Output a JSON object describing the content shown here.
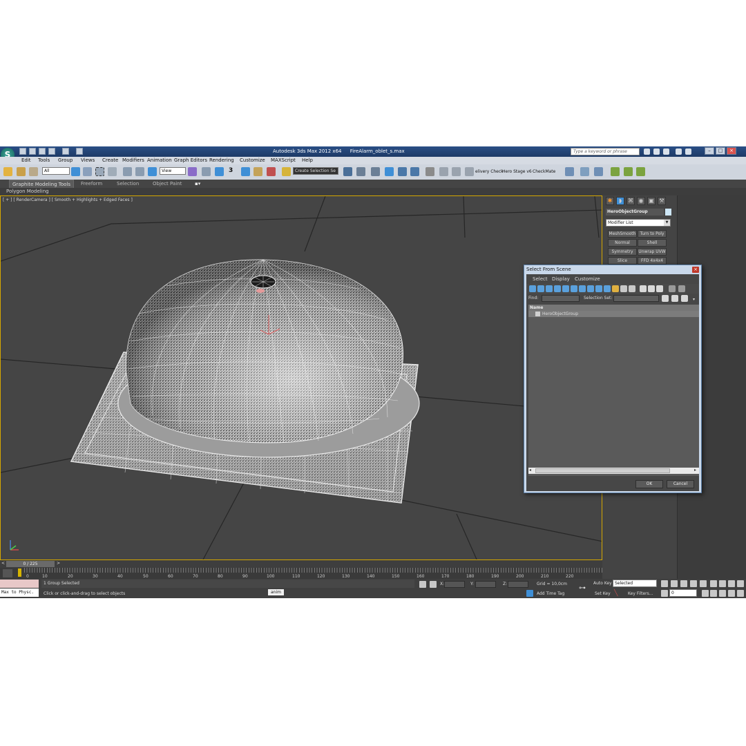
{
  "window": {
    "app_title": "Autodesk 3ds Max  2012 x64",
    "file_name": "FireAlarm_oblet_s.max",
    "search_placeholder": "Type a keyword or phrase",
    "logo_glyph": "S"
  },
  "menu": [
    "Edit",
    "Tools",
    "Group",
    "Views",
    "Create",
    "Modifiers",
    "Animation",
    "Graph Editors",
    "Rendering",
    "Customize",
    "MAXScript",
    "Help"
  ],
  "toolbar": {
    "selection_filter": "All",
    "ref_coord": "View",
    "named_selection_placeholder": "Create Selection Se",
    "snap_label": "3",
    "plugin_labels": [
      "elivery Check",
      "Hero Stage v6",
      "CheckMate"
    ]
  },
  "ribbon": {
    "tabs": [
      "Graphite Modeling Tools",
      "Freeform",
      "Selection",
      "Object Paint"
    ],
    "active_tab": "Graphite Modeling Tools",
    "sub_panel": "Polygon Modeling"
  },
  "viewport": {
    "label": "[ + ] [ RenderCamera ] [ Smooth + Highlights + Edged Faces ]"
  },
  "command_panel": {
    "object_name": "HeroObjectGroup",
    "object_color": "#cde6f5",
    "modifier_list_label": "Modifier List",
    "modifier_buttons": [
      "MeshSmooth",
      "Turn to Poly",
      "Normal",
      "Shell",
      "Symmetry",
      "Unwrap UVW",
      "Slice",
      "FFD 4x4x4"
    ]
  },
  "dialog": {
    "title": "Select From Scene",
    "menu": [
      "Select",
      "Display",
      "Customize"
    ],
    "find_label": "Find:",
    "selection_set_label": "Selection Set:",
    "column_header": "Name",
    "items": [
      "HeroObjectGroup"
    ],
    "ok_label": "OK",
    "cancel_label": "Cancel"
  },
  "timeline": {
    "frame_label": "0 / 225",
    "ticks": [
      "0",
      "10",
      "20",
      "30",
      "40",
      "50",
      "60",
      "70",
      "80",
      "90",
      "100",
      "110",
      "120",
      "130",
      "140",
      "150",
      "160",
      "170",
      "180",
      "190",
      "200",
      "210",
      "220"
    ]
  },
  "status": {
    "maxscript_text": "Max to Physc.",
    "selection_status": "1 Group Selected",
    "prompt": "Click or click-and-drag to select objects",
    "anim_badge": "anim",
    "x_label": "X:",
    "y_label": "Y:",
    "z_label": "Z:",
    "grid": "Grid = 10,0cm",
    "add_time_tag": "Add Time Tag",
    "auto_key": "Auto Key",
    "auto_key_mode": "Selected",
    "set_key": "Set Key",
    "key_filters": "Key Filters...",
    "current_frame": "0"
  },
  "colors": {
    "viewport_bg": "#454545",
    "active_viewport_border": "#d6a800",
    "titlebar": "#1d3a66",
    "dialog_frame": "#c9d8ea"
  }
}
